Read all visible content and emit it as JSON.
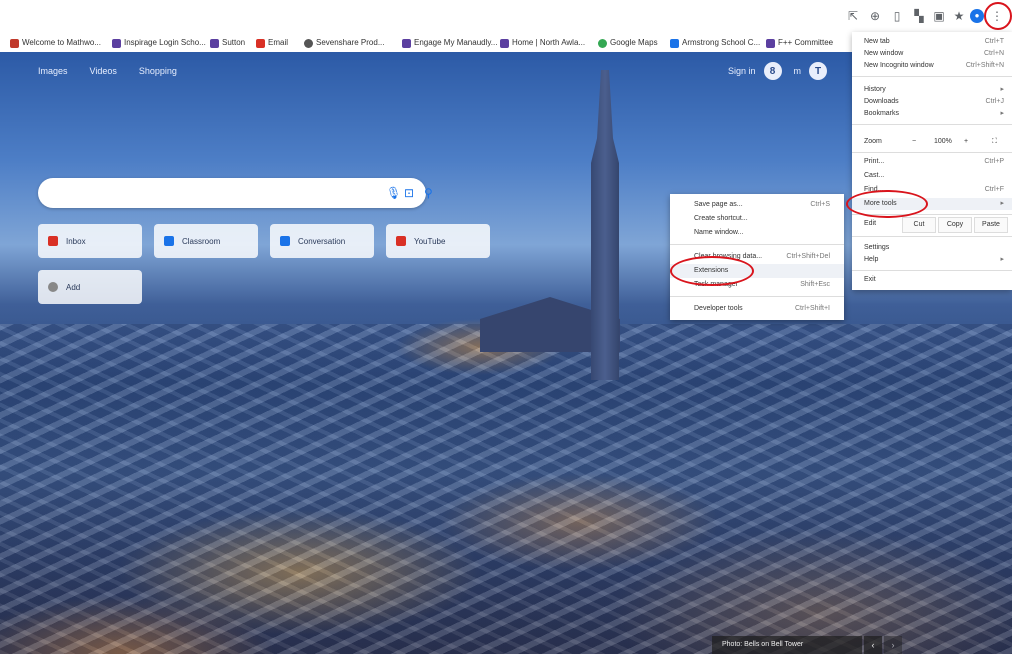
{
  "toolbar": {
    "icons": [
      "share-icon",
      "zoom-icon",
      "tab-icon",
      "media-icon",
      "lock-icon",
      "star-icon",
      "profile-icon",
      "more-icon"
    ],
    "profile_color": "#1a73e8"
  },
  "bookmarks": [
    {
      "label": "Welcome to Mathwo...",
      "color": "#c0392b"
    },
    {
      "label": "Inspirage Login Scho...",
      "color": "#5b3fa0"
    },
    {
      "label": "Sutton",
      "color": "#5b3fa0"
    },
    {
      "label": "Email",
      "color": "#d93025"
    },
    {
      "label": "Sevenshare Prod...",
      "color": "#555"
    },
    {
      "label": "Engage My Manaudly...",
      "color": "#5b3fa0"
    },
    {
      "label": "Home | North Awla...",
      "color": "#5b3fa0"
    },
    {
      "label": "Google Maps",
      "color": "#34a853"
    },
    {
      "label": "Armstrong School C...",
      "color": "#1a73e8"
    },
    {
      "label": "F++ Committee",
      "color": "#5b3fa0"
    }
  ],
  "ntp": {
    "links": [
      "Images",
      "Videos",
      "Shopping"
    ],
    "sign_in": "Sign in",
    "avatar_letter": "8",
    "apps_label": "m",
    "bing_letter": "T"
  },
  "search": {
    "placeholder": "",
    "mic_icon": "mic-icon",
    "lens_icon": "lens-icon",
    "search_icon": "search-icon"
  },
  "shortcuts": [
    {
      "label": "Inbox",
      "color": "#d93025"
    },
    {
      "label": "Classroom",
      "color": "#1a73e8"
    },
    {
      "label": "Conversation",
      "color": "#1a73e8"
    },
    {
      "label": "YouTube",
      "color": "#d93025"
    },
    {
      "label": "Add",
      "color": "#888"
    }
  ],
  "submenu": {
    "items": [
      {
        "label": "Save page as...",
        "shortcut": "Ctrl+S"
      },
      {
        "label": "Create shortcut...",
        "shortcut": ""
      },
      {
        "label": "Name window...",
        "shortcut": ""
      },
      {
        "label": "Clear browsing data...",
        "shortcut": "Ctrl+Shift+Del"
      },
      {
        "label": "Extensions",
        "shortcut": ""
      },
      {
        "label": "Task manager",
        "shortcut": "Shift+Esc"
      },
      {
        "label": "Developer tools",
        "shortcut": "Ctrl+Shift+I"
      }
    ]
  },
  "mainmenu": {
    "items_top": [
      {
        "label": "New tab",
        "shortcut": "Ctrl+T"
      },
      {
        "label": "New window",
        "shortcut": "Ctrl+N"
      },
      {
        "label": "New Incognito window",
        "shortcut": "Ctrl+Shift+N"
      }
    ],
    "items_mid": [
      {
        "label": "History",
        "shortcut": ""
      },
      {
        "label": "Downloads",
        "shortcut": "Ctrl+J"
      },
      {
        "label": "Bookmarks",
        "shortcut": ""
      }
    ],
    "zoom": {
      "label": "Zoom",
      "minus": "−",
      "value": "100%",
      "plus": "+",
      "fullscreen": "⛶"
    },
    "items_print": [
      {
        "label": "Print...",
        "shortcut": "Ctrl+P"
      },
      {
        "label": "Cast...",
        "shortcut": ""
      },
      {
        "label": "Find...",
        "shortcut": "Ctrl+F"
      },
      {
        "label": "More tools",
        "shortcut": ""
      }
    ],
    "edit": {
      "label": "Edit",
      "cut": "Cut",
      "copy": "Copy",
      "paste": "Paste"
    },
    "items_bottom": [
      {
        "label": "Settings",
        "shortcut": ""
      },
      {
        "label": "Help",
        "shortcut": ""
      }
    ],
    "exit": "Exit"
  },
  "credit": {
    "text": "Photo: Bells on Bell Tower",
    "prev": "‹",
    "next": "›"
  }
}
